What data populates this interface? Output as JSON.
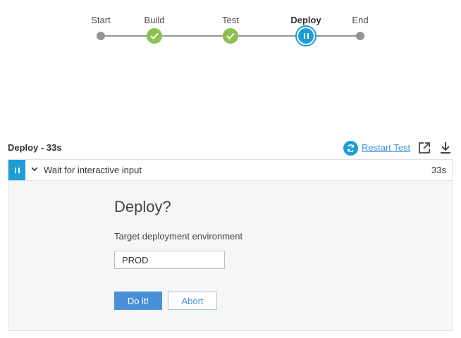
{
  "pipeline": {
    "stages": [
      {
        "label": "Start",
        "status": "start"
      },
      {
        "label": "Build",
        "status": "success"
      },
      {
        "label": "Test",
        "status": "success"
      },
      {
        "label": "Deploy",
        "status": "paused",
        "active": true
      },
      {
        "label": "End",
        "status": "end"
      }
    ]
  },
  "step_header": {
    "title": "Deploy - 33s",
    "restart_label": "Restart Test"
  },
  "step_row": {
    "label": "Wait for interactive input",
    "duration": "33s"
  },
  "input_panel": {
    "title": "Deploy?",
    "field_label": "Target deployment environment",
    "field_value": "PROD",
    "proceed_label": "Do it!",
    "abort_label": "Abort"
  },
  "colors": {
    "accent": "#1d9ed9",
    "success": "#8cc04f",
    "link": "#4a90d9",
    "connector": "#949494"
  },
  "icons": {
    "restart": "restart-icon",
    "open": "open-in-new-window-icon",
    "download": "download-icon",
    "paused": "pause-icon",
    "success": "check-icon",
    "expand": "chevron-down-icon"
  }
}
